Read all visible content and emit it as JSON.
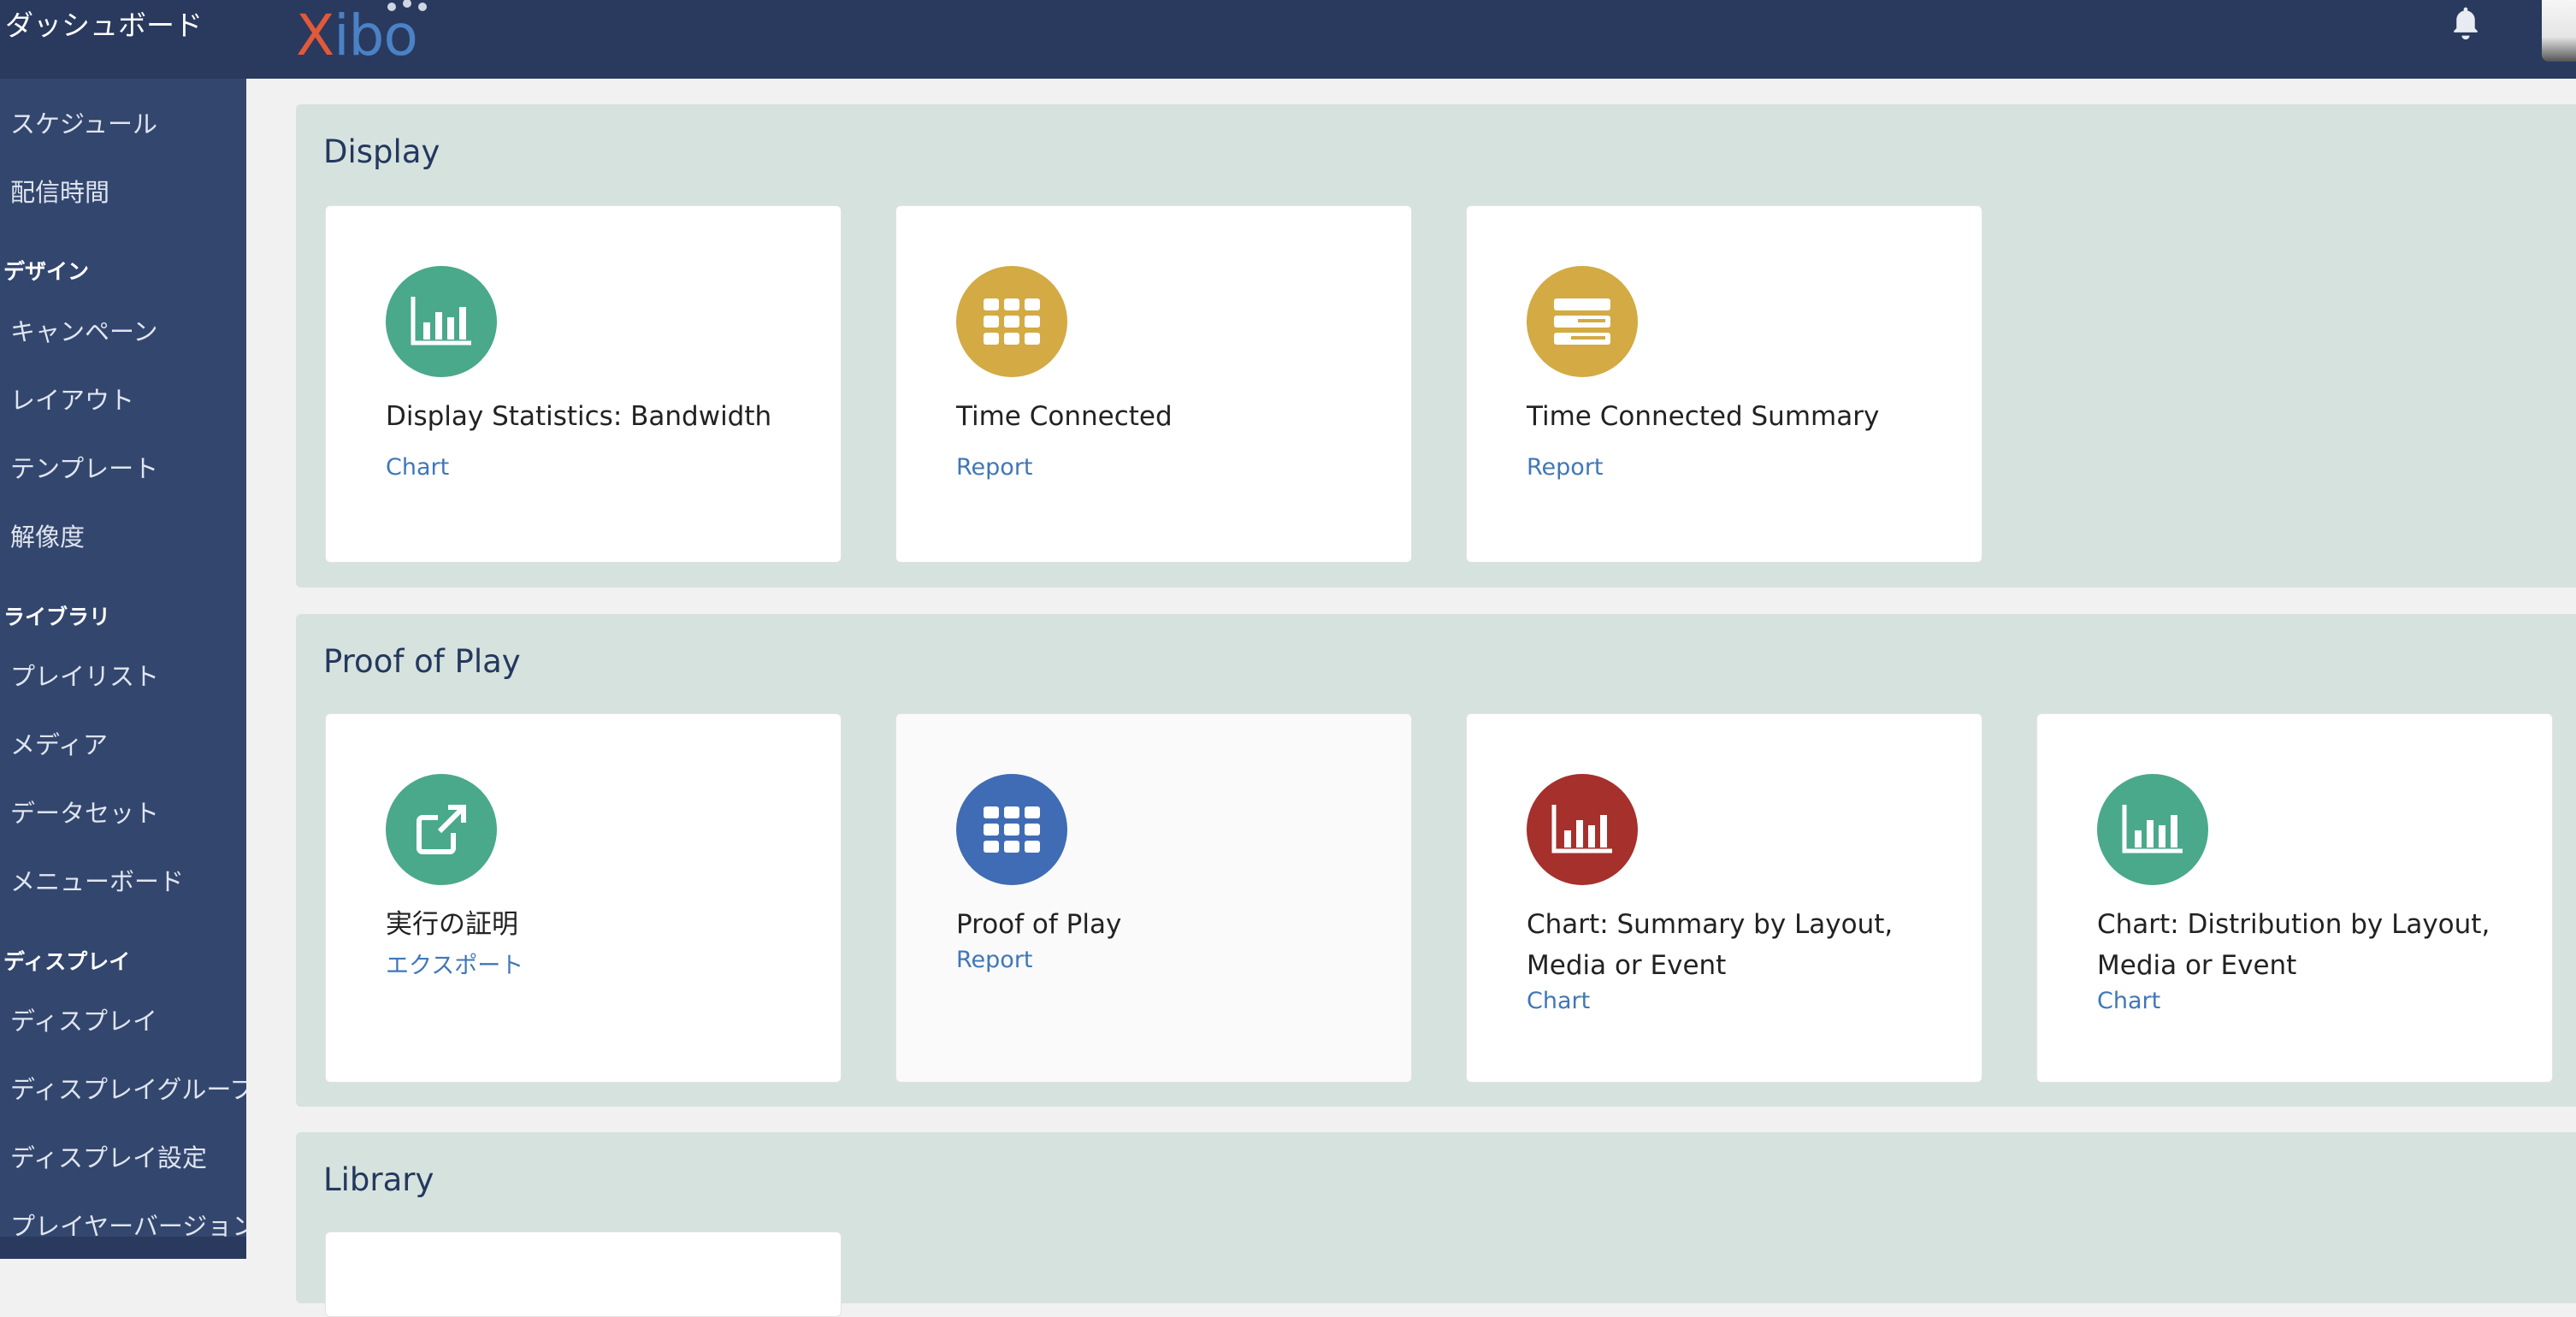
{
  "header": {
    "sidebar_title": "ダッシュボード",
    "logo_x": "X",
    "logo_rest": "ibo"
  },
  "sidebar": {
    "items": [
      {
        "label": "スケジュール",
        "kind": "item"
      },
      {
        "label": "配信時間",
        "kind": "item"
      },
      {
        "label": "デザイン",
        "kind": "head"
      },
      {
        "label": "キャンペーン",
        "kind": "item"
      },
      {
        "label": "レイアウト",
        "kind": "item"
      },
      {
        "label": "テンプレート",
        "kind": "item"
      },
      {
        "label": "解像度",
        "kind": "item"
      },
      {
        "label": "ライブラリ",
        "kind": "head"
      },
      {
        "label": "プレイリスト",
        "kind": "item"
      },
      {
        "label": "メディア",
        "kind": "item"
      },
      {
        "label": "データセット",
        "kind": "item"
      },
      {
        "label": "メニューボード",
        "kind": "item"
      },
      {
        "label": "ディスプレイ",
        "kind": "head"
      },
      {
        "label": "ディスプレイ",
        "kind": "item"
      },
      {
        "label": "ディスプレイグループ",
        "kind": "item"
      },
      {
        "label": "ディスプレイ設定",
        "kind": "item"
      },
      {
        "label": "プレイヤーバージョン",
        "kind": "item"
      }
    ]
  },
  "sections": {
    "display": {
      "title": "Display",
      "cards": [
        {
          "title": "Display Statistics: Bandwidth",
          "sub": "Chart",
          "icon": "bar-chart-icon",
          "color": "#4aa98a"
        },
        {
          "title": "Time Connected",
          "sub": "Report",
          "icon": "grid-icon",
          "color": "#d3aa44"
        },
        {
          "title": "Time Connected Summary",
          "sub": "Report",
          "icon": "list-summary-icon",
          "color": "#d3aa44"
        }
      ]
    },
    "proof_of_play": {
      "title": "Proof of Play",
      "cards": [
        {
          "title": "実行の証明",
          "sub": "エクスポート",
          "icon": "external-link-icon",
          "color": "#4aa98a"
        },
        {
          "title": "Proof of Play",
          "sub": "Report",
          "icon": "grid-icon",
          "color": "#3f6cb4"
        },
        {
          "title": "Chart: Summary by Layout, Media or Event",
          "sub": "Chart",
          "icon": "bar-chart-icon",
          "color": "#a6302c"
        },
        {
          "title": "Chart: Distribution by Layout, Media or Event",
          "sub": "Chart",
          "icon": "bar-chart-icon",
          "color": "#4aa98a"
        }
      ]
    },
    "library": {
      "title": "Library"
    }
  }
}
